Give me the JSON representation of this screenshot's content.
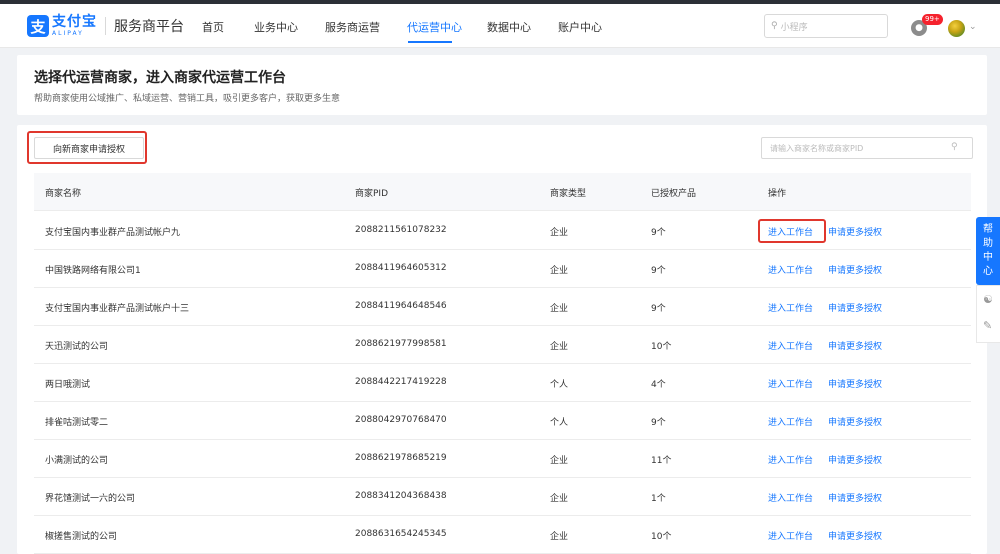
{
  "brand": {
    "logo_glyph": "支",
    "logo_cn": "支付宝",
    "logo_en": "ALIPAY",
    "platform": "服务商平台",
    "accent_color": "#1677ff"
  },
  "nav": {
    "items": [
      {
        "label": "首页"
      },
      {
        "label": "业务中心"
      },
      {
        "label": "服务商运营"
      },
      {
        "label": "代运营中心"
      },
      {
        "label": "数据中心"
      },
      {
        "label": "账户中心"
      }
    ],
    "active_index": 3
  },
  "topbar": {
    "search_placeholder": "小程序",
    "notification_count": "99+"
  },
  "header": {
    "title": "选择代运营商家，进入商家代运营工作台",
    "subtitle": "帮助商家使用公域推广、私域运营、营销工具，吸引更多客户，获取更多生意"
  },
  "toolbar": {
    "apply_button": "向新商家申请授权",
    "search_placeholder": "请输入商家名称或商家PID"
  },
  "table": {
    "columns": [
      "商家名称",
      "商家PID",
      "商家类型",
      "已授权产品",
      "操作"
    ],
    "actions": {
      "enter": "进入工作台",
      "more": "申请更多授权"
    },
    "rows": [
      {
        "name": "支付宝国内事业群产品测试帐户九",
        "pid": "2088211561078232",
        "type": "企业",
        "products": "9个"
      },
      {
        "name": "中国铁路网络有限公司1",
        "pid": "2088411964605312",
        "type": "企业",
        "products": "9个"
      },
      {
        "name": "支付宝国内事业群产品测试帐户十三",
        "pid": "2088411964648546",
        "type": "企业",
        "products": "9个"
      },
      {
        "name": "天迅测试的公司",
        "pid": "2088621977998581",
        "type": "企业",
        "products": "10个"
      },
      {
        "name": "两日哦测试",
        "pid": "2088442217419228",
        "type": "个人",
        "products": "4个"
      },
      {
        "name": "排雀咕测试零二",
        "pid": "2088042970768470",
        "type": "个人",
        "products": "9个"
      },
      {
        "name": "小满测试的公司",
        "pid": "2088621978685219",
        "type": "企业",
        "products": "11个"
      },
      {
        "name": "界花馇测试一六的公司",
        "pid": "2088341204368438",
        "type": "企业",
        "products": "1个"
      },
      {
        "name": "椒搓售测试的公司",
        "pid": "2088631654245345",
        "type": "企业",
        "products": "10个"
      }
    ]
  },
  "help": {
    "chars": [
      "帮",
      "助",
      "中",
      "心"
    ],
    "icons": [
      "headset-icon",
      "edit-icon"
    ]
  }
}
